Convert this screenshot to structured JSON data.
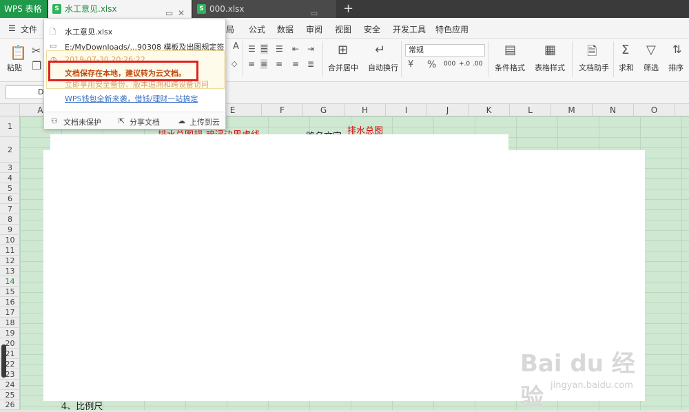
{
  "tabs": {
    "app": "WPS 表格",
    "doc1": "水工意见.xlsx",
    "doc2": "000.xlsx"
  },
  "menu": {
    "file": "文件",
    "items": [
      "局",
      "公式",
      "数据",
      "审阅",
      "视图",
      "安全",
      "开发工具",
      "特色应用"
    ]
  },
  "ribbon": {
    "paste": "粘贴",
    "merge_center": "合并居中",
    "wrap": "自动换行",
    "number_format": "常规",
    "conditional_format": "条件格式",
    "table_style": "表格样式",
    "doc_assistant": "文档助手",
    "sum": "求和",
    "filter": "筛选",
    "sort": "排序"
  },
  "namebox": "D",
  "columns": [
    "A",
    "B",
    "C",
    "D",
    "E",
    "F",
    "G",
    "H",
    "I",
    "J",
    "K",
    "L",
    "M",
    "N",
    "O"
  ],
  "rows": [
    "1",
    "2",
    "3",
    "4",
    "5",
    "6",
    "7",
    "8",
    "9",
    "10",
    "11",
    "12",
    "13",
    "14",
    "15",
    "16",
    "17",
    "18",
    "19",
    "20",
    "21",
    "22",
    "23",
    "24",
    "25",
    "26"
  ],
  "cells": {
    "d2": "排水总图规",
    "e2": "暗浸边界虚线",
    "g2": "路名文字",
    "h1": "排水总图",
    "b26": "4、比例尺"
  },
  "popup": {
    "filename": "水工意见.xlsx",
    "path": "E:/MyDownloads/...90308 模板及出图规定签名",
    "time": "2019-07-30 20:26:22",
    "warning": "文档保存在本地，建议转为云文档。",
    "warning_sub": "立即享用安全备份、版本追溯和跨设备访问",
    "link": "WPS钱包全新来袭，借钱/理财一站搞定",
    "footer": {
      "protect": "文档未保护",
      "share": "分享文档",
      "upload": "上传到云"
    }
  },
  "watermark": {
    "main": "Bai du 经验",
    "sub": "jingyan.baidu.com"
  }
}
